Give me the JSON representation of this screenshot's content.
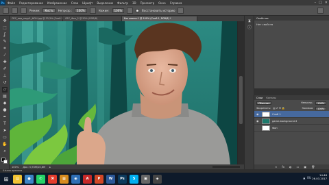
{
  "menubar": {
    "logo": "Ps",
    "items": [
      "Файл",
      "Редактирование",
      "Изображение",
      "Слои",
      "Шрифт",
      "Выделение",
      "Фильтр",
      "3D",
      "Просмотр",
      "Окно",
      "Справка"
    ],
    "window_controls": [
      "–",
      "□",
      "✕"
    ]
  },
  "options": {
    "mode_label": "Режим:",
    "mode_value": "Кисть",
    "opacity_label": "Непрозр.:",
    "opacity_value": "100%",
    "flow_label": "Нажим:",
    "flow_value": "100%",
    "erase_history_label": "Восстановить историю"
  },
  "tabs": [
    {
      "label": "ЛЕС_вид_кадр1_ФОН.jpg @ 33,3% (Слой 1, RGB/8)",
      "active": false
    },
    {
      "label": "ЛЕС_Фон_2 @ 50% (RGB/8)",
      "active": false
    },
    {
      "label": "Без имени-1 @ 100% (Слой 1, RGB/8) *",
      "active": true
    }
  ],
  "status": {
    "zoom": "100%",
    "doc_label": "Док: 5,93М/10,8М"
  },
  "bottom_strip": {
    "label": "Шкала времени"
  },
  "props_panel": {
    "tab": "Свойства",
    "subtitle": "Нет свойств"
  },
  "layers_panel": {
    "tabs": [
      "Слои",
      "Каналы"
    ],
    "kind_label": "Обычные",
    "opacity_label": "Непрозр.:",
    "opacity_value": "100%",
    "lock_label": "Закрепить:",
    "fill_label": "Заливка:",
    "fill_value": "100%",
    "layers": [
      {
        "name": "Слой 1",
        "selected": true,
        "thumb": "person"
      },
      {
        "name": "game-background-3",
        "selected": false,
        "thumb": "jungle"
      },
      {
        "name": "Фон",
        "selected": false,
        "thumb": "white"
      }
    ],
    "footer_icons": [
      "∞",
      "fx",
      "◐",
      "▭",
      "▣",
      "🗑"
    ]
  },
  "taskbar": {
    "apps": [
      {
        "name": "explorer",
        "glyph": "▤",
        "color": "#f1c232"
      },
      {
        "name": "chrome",
        "glyph": "●",
        "color": "#3d85c6"
      },
      {
        "name": "whatsapp",
        "glyph": "✆",
        "color": "#25d366"
      },
      {
        "name": "yandex",
        "glyph": "Я",
        "color": "#e23c2c"
      },
      {
        "name": "files",
        "glyph": "▦",
        "color": "#d68b1f"
      },
      {
        "name": "app-blue",
        "glyph": "◉",
        "color": "#2e6fb5"
      },
      {
        "name": "pdf",
        "glyph": "A",
        "color": "#c62828"
      },
      {
        "name": "ppt",
        "glyph": "P",
        "color": "#d24726"
      },
      {
        "name": "word",
        "glyph": "W",
        "color": "#2b5797"
      },
      {
        "name": "photoshop",
        "glyph": "Ps",
        "color": "#0c3a5c"
      },
      {
        "name": "skype",
        "glyph": "S",
        "color": "#00aff0"
      },
      {
        "name": "calc",
        "glyph": "▣",
        "color": "#666666"
      },
      {
        "name": "app-dark",
        "glyph": "◈",
        "color": "#444444"
      }
    ],
    "tray_lang": "RU",
    "time": "14:48",
    "date": "26.03.2017"
  }
}
